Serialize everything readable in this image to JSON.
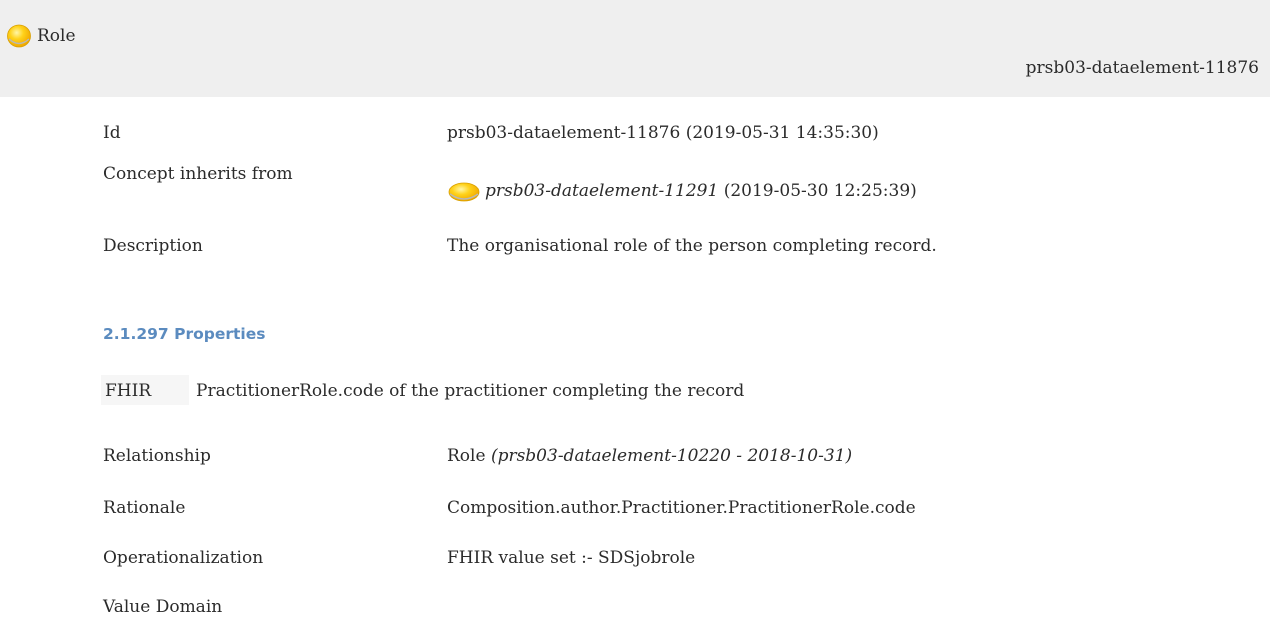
{
  "header": {
    "title": "Role",
    "id": "prsb03-dataelement-11876",
    "icon": "concept-yellow-circle-icon"
  },
  "rows": [
    {
      "label": "Id",
      "value": "prsb03-dataelement-11876 (2019-05-31 14:35:30)"
    },
    {
      "label": "Concept inherits from",
      "value_ref": "prsb03-dataelement-11291",
      "value_suffix": " (2019-05-30 12:25:39)",
      "icon": "concept-yellow-circle-icon"
    },
    {
      "label": "Description",
      "value": "The organisational role of the person completing record."
    }
  ],
  "properties": {
    "heading": "2.1.297 Properties",
    "fhir_label": "FHIR",
    "fhir_text": "PractitionerRole.code of the practitioner completing the record",
    "rows": [
      {
        "label": "Relationship",
        "value": "Role ",
        "value_italic": "(prsb03-dataelement-10220 - 2018-10-31)"
      },
      {
        "label": "Rationale",
        "value": "Composition.author.Practitioner.PractitionerRole.code"
      },
      {
        "label": "Operationalization",
        "value": "FHIR value set :- SDSjobrole"
      },
      {
        "label": "Value Domain",
        "value": ""
      }
    ]
  },
  "colors": {
    "header_bg": "#efefef",
    "heading": "#5b8bbf",
    "icon_yellow": "#f5c400"
  }
}
